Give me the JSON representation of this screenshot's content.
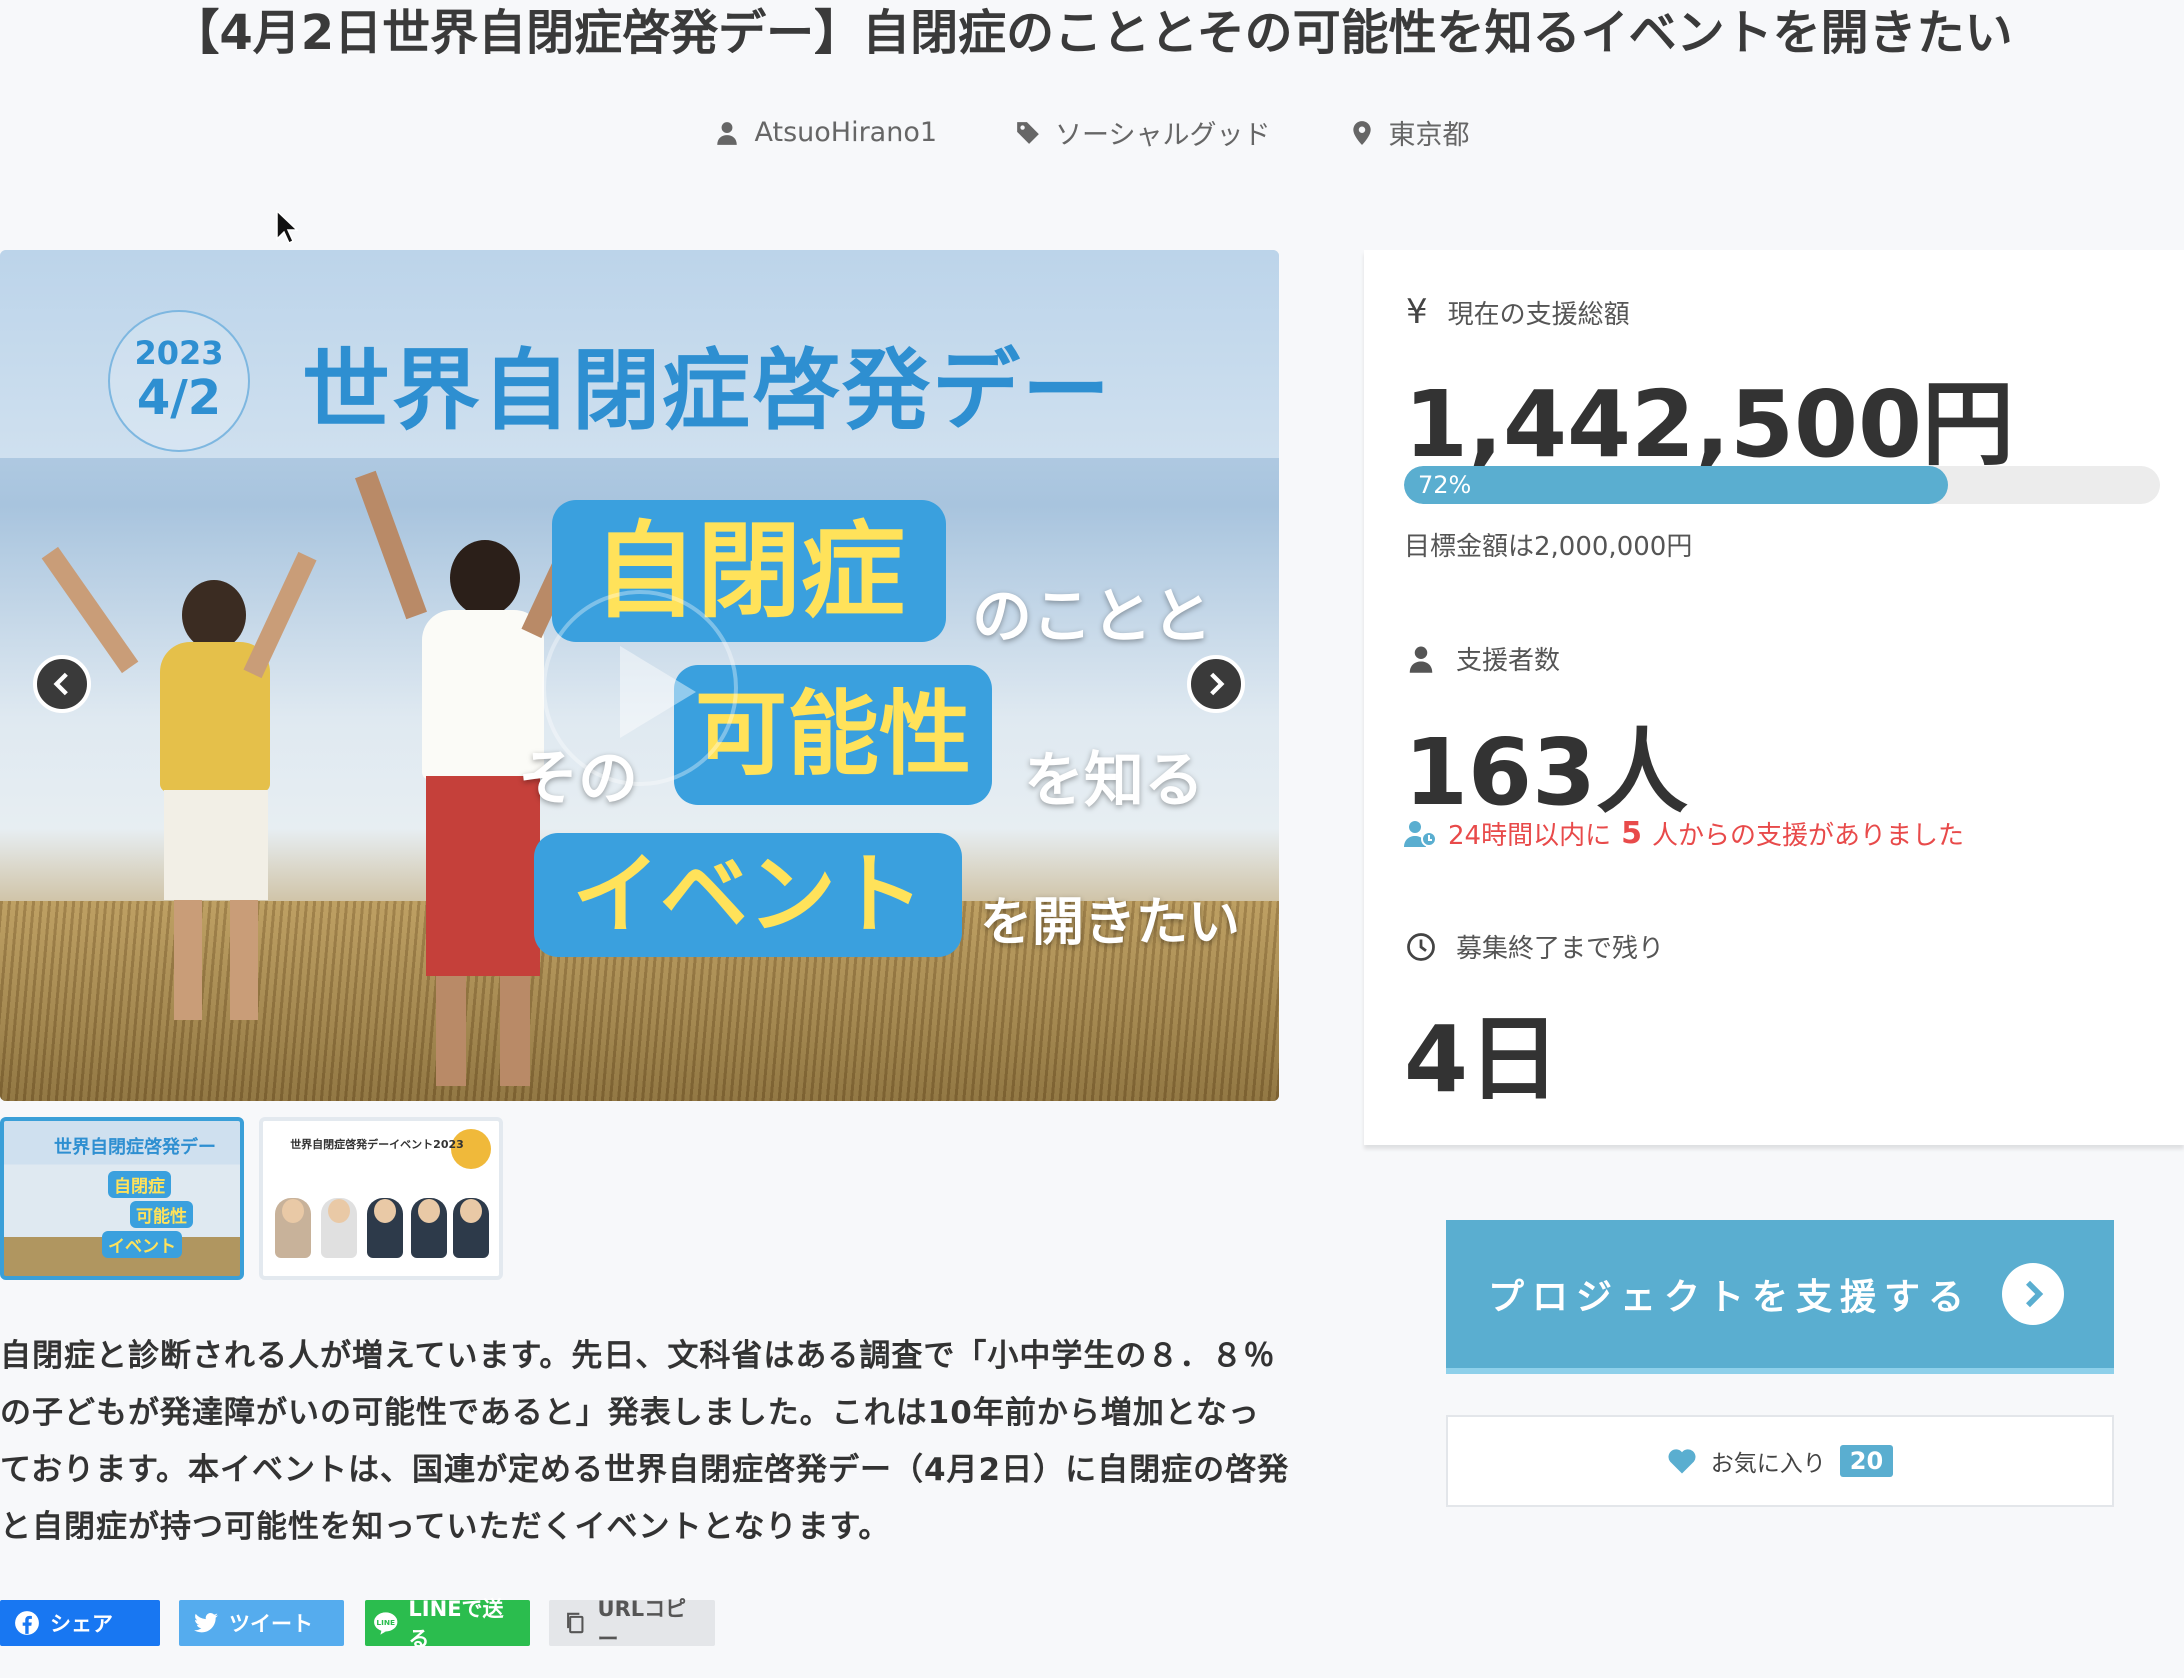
{
  "page": {
    "title": "【4月2日世界自閉症啓発デー】自閉症のこととその可能性を知るイベントを開きたい"
  },
  "meta": {
    "author": "AtsuoHirano1",
    "category": "ソーシャルグッド",
    "location": "東京都"
  },
  "slider": {
    "slide_year": "2023",
    "slide_date": "4/2",
    "slide_heading": "世界自閉症啓発デー",
    "slide_box1": "自閉症",
    "slide_text1": "のことと",
    "slide_text2": "その",
    "slide_box2": "可能性",
    "slide_text3": "を知る",
    "slide_box3": "イベント",
    "slide_text4": "を開きたい"
  },
  "thumbnails": {
    "thumb1_heading": "世界自閉症啓発デー",
    "thumb1_box1": "自閉症",
    "thumb1_box2": "可能性",
    "thumb1_box3": "イベント",
    "thumb2_heading": "世界自閉症啓発デーイベント2023"
  },
  "description": "自閉症と診断される人が増えています。先日、文科省はある調査で「小中学生の８．８％の子どもが発達障がいの可能性であると」発表しました。これは10年前から増加となっております。本イベントは、国連が定める世界自閉症啓発デー（4月2日）に自閉症の啓発と自閉症が持つ可能性を知っていただくイベントとなります。",
  "share": {
    "facebook": "シェア",
    "twitter": "ツイート",
    "line": "LINEで送る",
    "url_copy": "URLコピー"
  },
  "stats": {
    "currency_symbol": "¥",
    "total_label": "現在の支援総額",
    "total_value": "1,442,500円",
    "progress_percent": 72,
    "progress_text": "72%",
    "goal_text": "目標金額は2,000,000円",
    "supporters_label": "支援者数",
    "supporters_value": "163人",
    "recent_prefix": "24時間以内に",
    "recent_count": "5",
    "recent_suffix": "人からの支援がありました",
    "remaining_label": "募集終了まで残り",
    "remaining_value": "4日"
  },
  "actions": {
    "support_button": "プロジェクトを支援する",
    "favorite_label": "お気に入り",
    "favorite_count": "20"
  },
  "colors": {
    "accent": "#5aaed0",
    "alert": "#e84a4a",
    "slide_blue": "#3aa0de",
    "slide_yellow": "#ffe25a"
  }
}
